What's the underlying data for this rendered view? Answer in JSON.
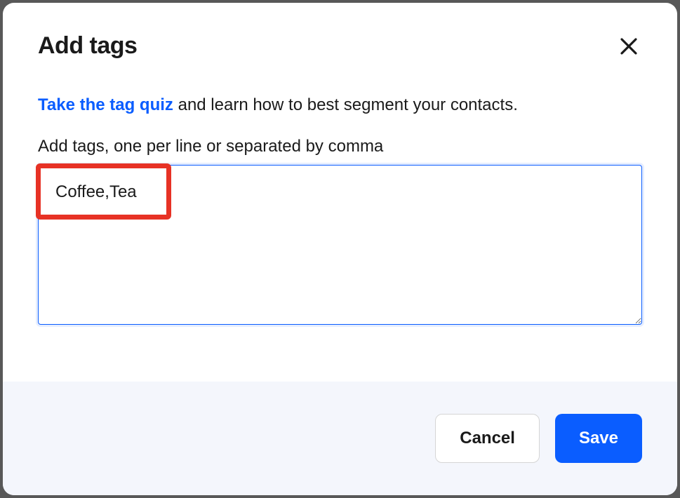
{
  "modal": {
    "title": "Add tags",
    "helper": {
      "link_text": "Take the tag quiz",
      "suffix_text": " and learn how to best segment your contacts."
    },
    "field_label": "Add tags, one per line or separated by comma",
    "textarea_value": "Coffee,Tea",
    "buttons": {
      "cancel": "Cancel",
      "save": "Save"
    }
  }
}
